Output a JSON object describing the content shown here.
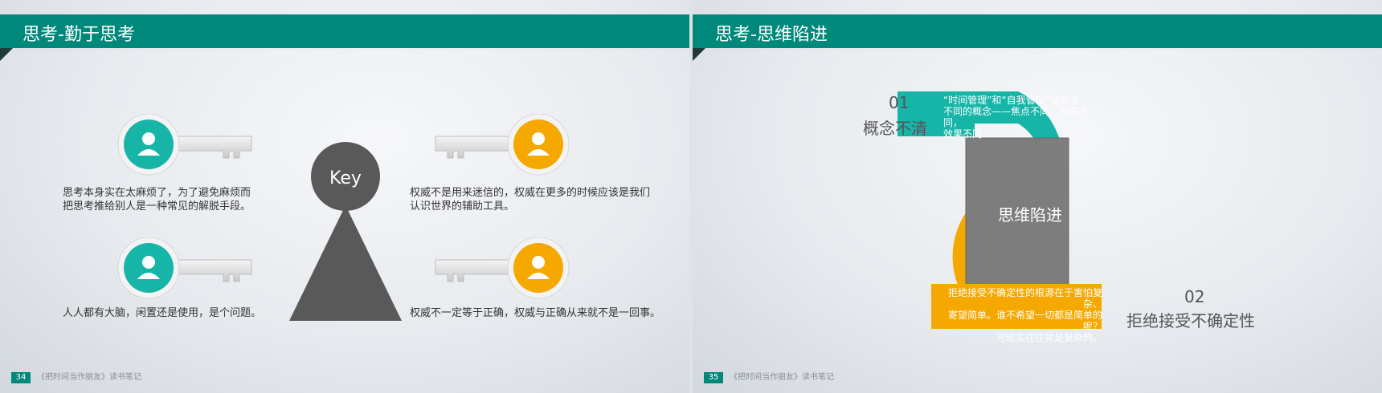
{
  "left_slide": {
    "title": "思考-勤于思考",
    "center_label": "Key",
    "captions": [
      "思考本身实在太麻烦了，为了避免麻烦而\n把思考推给别人是一种常见的解脱手段。",
      "人人都有大脑，闲置还是使用，是个问题。",
      "权威不是用来迷信的，权威在更多的时候应该是我们\n认识世界的辅助工具。",
      "权威不一定等于正确，权威与正确从来就不是一回事。"
    ],
    "page_number": "34",
    "footer_text": "《把时间当作朋友》读书笔记"
  },
  "right_slide": {
    "title": "思考-思维陷进",
    "center_label": "思维陷进",
    "item1": {
      "number": "01",
      "title": "概念不清",
      "desc": "“时间管理”和“自我管理”是完全\n不同的概念——焦点不同，方法不同，\n效果不同……"
    },
    "item2": {
      "number": "02",
      "title": "拒绝接受不确定性",
      "desc": "拒绝接受不确定性的根源在于害怕复杂、\n寄望简单。谁不希望一切都是简单的呢？\n可现实往往就是复杂的。"
    },
    "page_number": "35",
    "footer_text": "《把时间当作朋友》读书笔记"
  },
  "colors": {
    "teal": "#00897b",
    "aqua": "#17b5a8",
    "orange": "#f5a800",
    "gray": "#595959",
    "block_gray": "#7d7d7d"
  }
}
